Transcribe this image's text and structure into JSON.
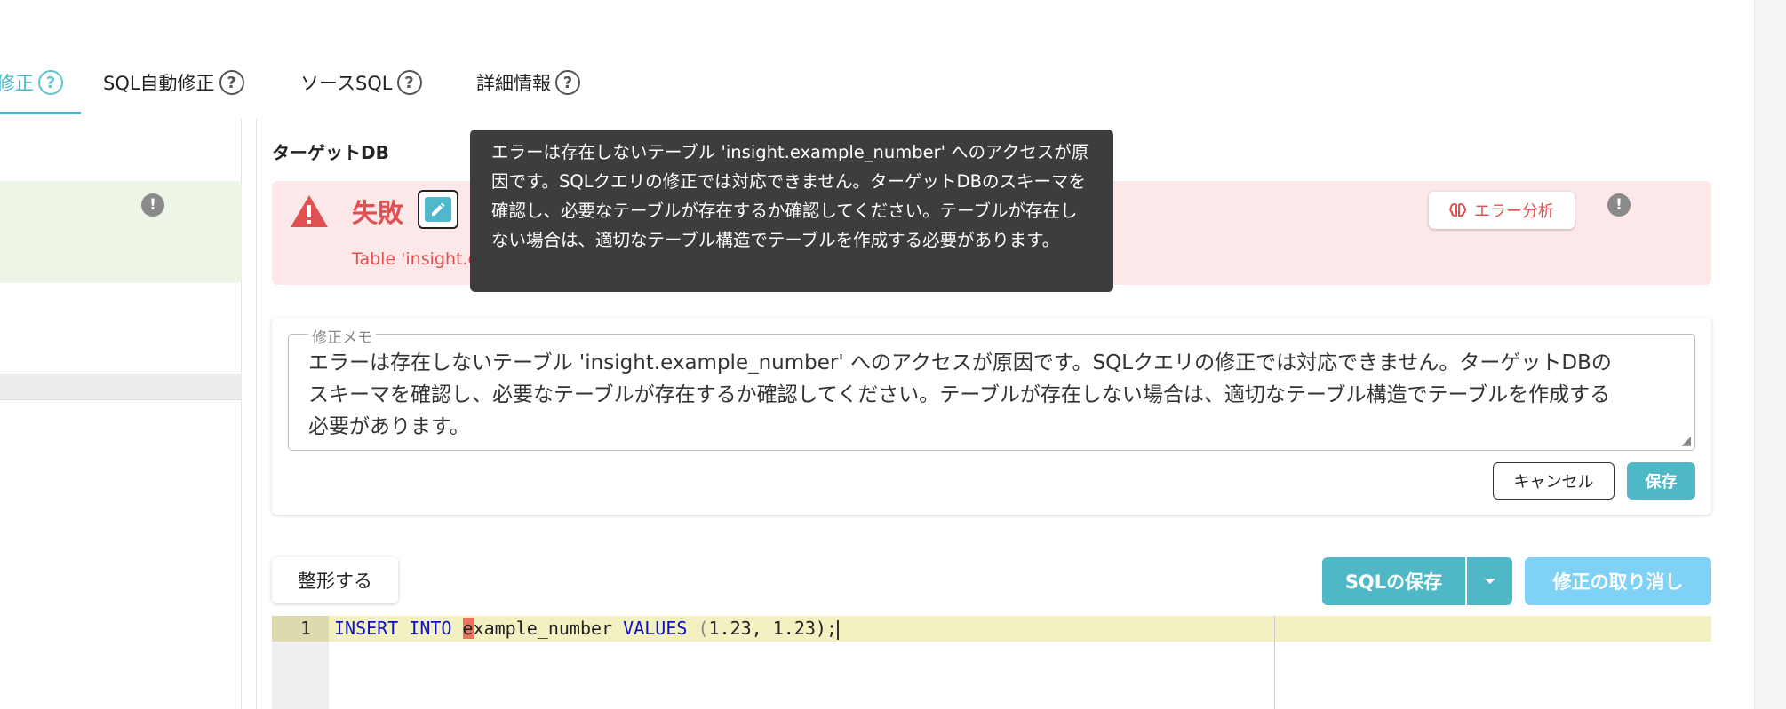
{
  "tabs": [
    {
      "label": "修正",
      "active": true
    },
    {
      "label": "SQL自動修正",
      "active": false
    },
    {
      "label": "ソースSQL",
      "active": false
    },
    {
      "label": "詳細情報",
      "active": false
    }
  ],
  "target_db": {
    "title": "ターゲットDB",
    "status_label": "失敗",
    "status_message": "Table 'insight.e",
    "error_analysis_label": "エラー分析"
  },
  "tooltip": {
    "text": "エラーは存在しないテーブル 'insight.example_number' へのアクセスが原因です。SQLクエリの修正では対応できません。ターゲットDBのスキーマを確認し、必要なテーブルが存在するか確認してください。テーブルが存在しない場合は、適切なテーブル構造でテーブルを作成する必要があります。"
  },
  "memo": {
    "legend": "修正メモ",
    "value": "エラーは存在しないテーブル 'insight.example_number' へのアクセスが原因です。SQLクエリの修正では対応できません。ターゲットDBのスキーマを確認し、必要なテーブルが存在するか確認してください。テーブルが存在しない場合は、適切なテーブル構造でテーブルを作成する必要があります。",
    "cancel_label": "キャンセル",
    "save_label": "保存"
  },
  "toolbar": {
    "format_label": "整形する",
    "save_sql_label": "SQLの保存",
    "undo_label": "修正の取り消し"
  },
  "editor": {
    "line_number": "1",
    "code": {
      "kw1": "INSERT",
      "kw2": "INTO",
      "err_char": "e",
      "table": "xample_number",
      "kw3": "VALUES",
      "open_paren": "(",
      "values": "1.23, 1.23",
      "close": ");"
    }
  },
  "icons": {
    "help": "question-circle-icon",
    "warning": "warning-triangle-icon",
    "edit": "pencil-icon",
    "info": "exclamation-circle-icon",
    "brain": "brain-icon",
    "dropdown": "caret-down-icon"
  },
  "colors": {
    "accent": "#46b8c8",
    "error": "#e05050",
    "fail_bg": "#fce8e8",
    "success_bg": "#edf5e6",
    "tooltip_bg": "#3d3d3d",
    "undo_bg": "#7fd2f5"
  }
}
